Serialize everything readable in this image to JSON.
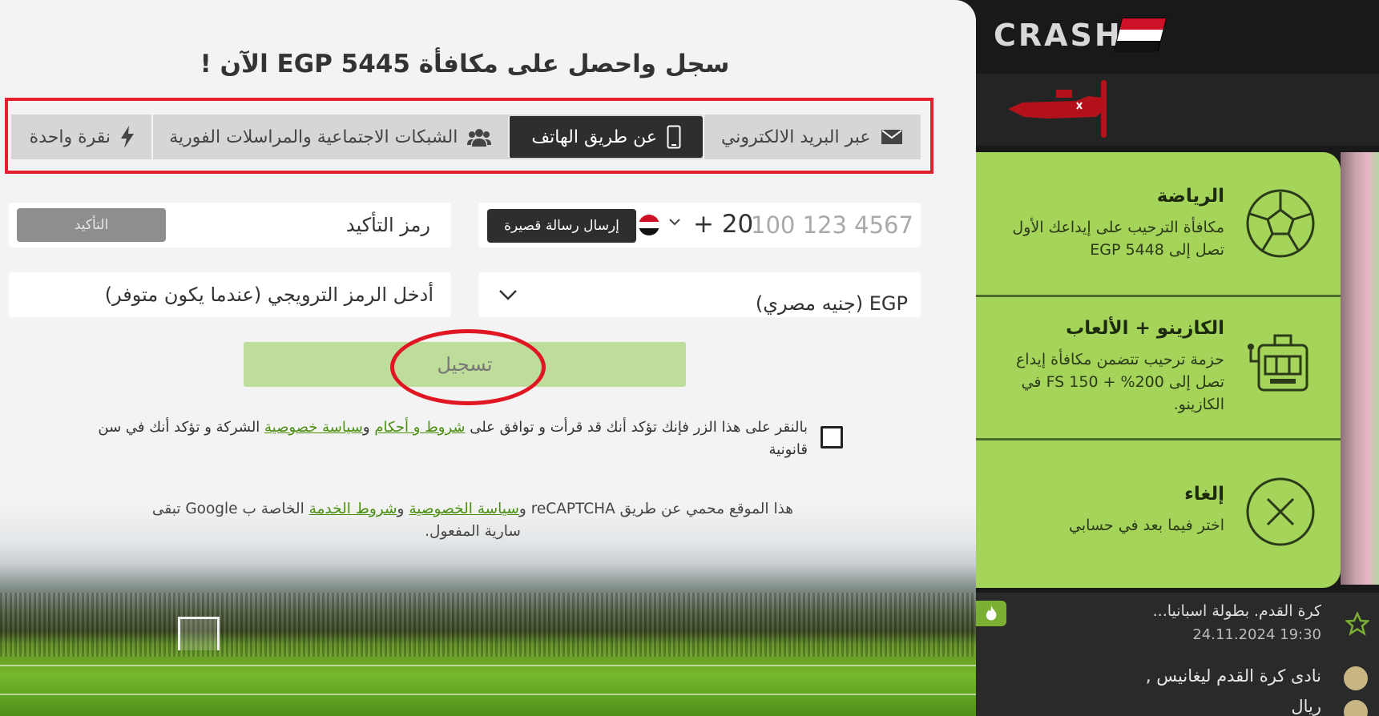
{
  "brand": {
    "name": "CRASH",
    "flag_colors": [
      "#ce1126",
      "#ffffff",
      "#111111"
    ]
  },
  "heading": "سجل واحصل على مكافأة EGP 5445 الآن !",
  "tabs": [
    {
      "label": "عبر البريد الالكتروني",
      "icon": "envelope-icon",
      "active": false
    },
    {
      "label": "عن طريق الهاتف",
      "icon": "mobile-phone-icon",
      "active": true
    },
    {
      "label": "الشبكات الاجتماعية والمراسلات الفورية",
      "icon": "users-icon",
      "active": false
    },
    {
      "label": "نقرة واحدة",
      "icon": "lightning-icon",
      "active": false
    }
  ],
  "phone": {
    "placeholder": "100 123 4567",
    "prefix": "+ 20",
    "country": "egypt-flag-icon",
    "send_sms": "إرسال رسالة قصيرة"
  },
  "code": {
    "placeholder": "رمز التأكيد",
    "confirm": "التأكيد"
  },
  "currency": {
    "value": "EGP (جنيه مصري)"
  },
  "promo": {
    "placeholder": "أدخل الرمز الترويجي (عندما يكون متوفر)"
  },
  "register": {
    "label": "تسجيل"
  },
  "terms": {
    "prefix": "بالنقر على هذا الزر فإنك تؤكد أنك قد قرأت و توافق على ",
    "link_terms": "شروط و أحكام",
    "mid": " و",
    "link_privacy": "سياسة خصوصية",
    "suffix": " الشركة و تؤكد أنك في سن قانونية"
  },
  "recaptcha": {
    "prefix": "هذا الموقع محمي عن طريق reCAPTCHA و",
    "link_privacy": "سياسة الخصوصية",
    "mid": " و",
    "link_terms": "شروط الخدمة",
    "suffix": " الخاصة ب Google تبقى سارية المفعول."
  },
  "bonus_options": [
    {
      "title": "الرياضة",
      "desc": "مكافأة الترحيب على إيداعك الأول تصل إلى EGP 5448",
      "icon": "soccer-ball-icon"
    },
    {
      "title": "الكازينو + الألعاب",
      "desc": "حزمة ترحيب تتضمن مكافأة إيداع تصل إلى 200% + 150 FS في الكازينو.",
      "icon": "slot-machine-icon"
    },
    {
      "title": "إلغاء",
      "desc": "اختر فيما بعد في حسابي",
      "icon": "cancel-x-icon"
    }
  ],
  "match": {
    "title": "كرة القدم. بطولة اسبانيا...",
    "time": "24.11.2024 19:30",
    "team_1": "نادى كرة القدم ليغانيس ,",
    "team_2": "ريال",
    "badge_icon": "flame-icon",
    "star_icon": "star-icon"
  }
}
